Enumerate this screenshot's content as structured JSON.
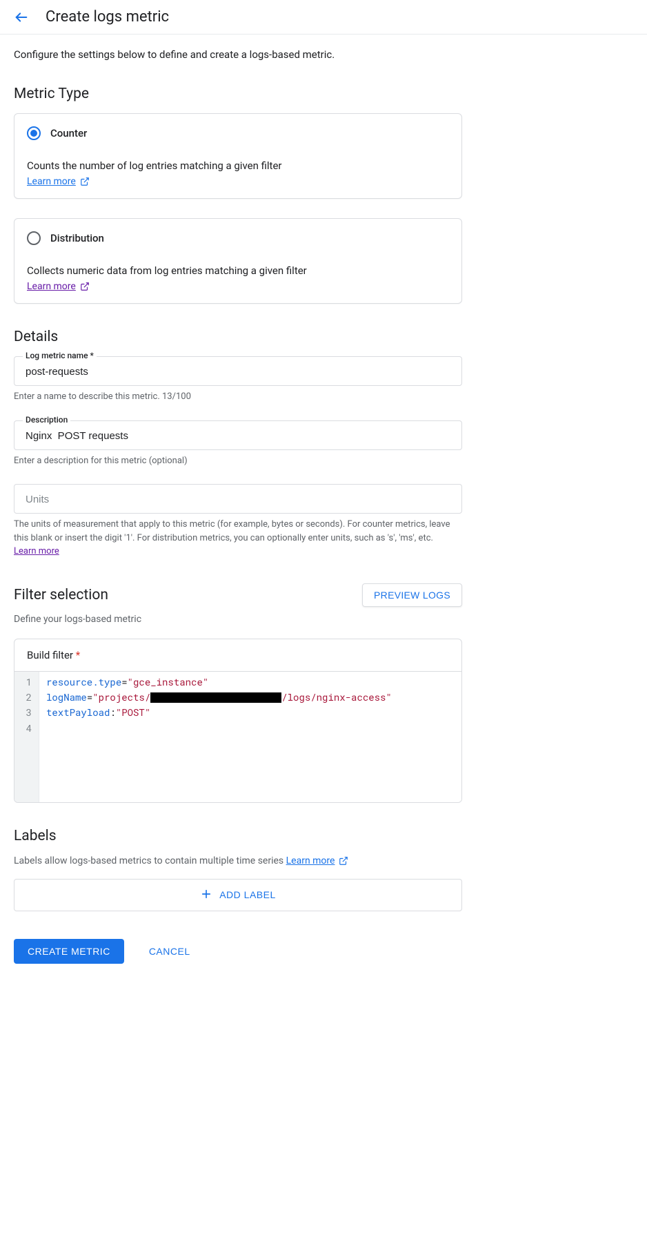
{
  "header": {
    "title": "Create logs metric"
  },
  "intro": "Configure the settings below to define and create a logs-based metric.",
  "metric_type": {
    "heading": "Metric Type",
    "counter": {
      "label": "Counter",
      "desc": "Counts the number of log entries matching a given filter",
      "learn": "Learn more"
    },
    "distribution": {
      "label": "Distribution",
      "desc": "Collects numeric data from log entries matching a given filter",
      "learn": "Learn more"
    }
  },
  "details": {
    "heading": "Details",
    "name_label": "Log metric name *",
    "name_value": "post-requests",
    "name_help": "Enter a name to describe this metric. 13/100",
    "desc_label": "Description",
    "desc_value": "Nginx  POST requests",
    "desc_help": "Enter a description for this metric (optional)",
    "units_placeholder": "Units",
    "units_help_pre": "The units of measurement that apply to this metric (for example, bytes or seconds). For counter metrics, leave this blank or insert the digit '1'. For distribution metrics, you can optionally enter units, such as 's', 'ms', etc. ",
    "units_learn": "Learn more"
  },
  "filter": {
    "heading": "Filter selection",
    "preview": "PREVIEW LOGS",
    "sub": "Define your logs-based metric",
    "build_label": "Build filter",
    "lines": {
      "1": {
        "k": "resource.type",
        "op": "=",
        "v": "\"gce_instance\""
      },
      "2": {
        "k": "logName",
        "op": "=",
        "v1": "\"projects/",
        "v2": "/logs/nginx-access\""
      },
      "3": {
        "k": "textPayload",
        "op": ":",
        "v": "\"POST\""
      }
    }
  },
  "labels": {
    "heading": "Labels",
    "desc": "Labels allow logs-based metrics to contain multiple time series ",
    "learn": "Learn more",
    "add": "ADD LABEL"
  },
  "actions": {
    "create": "CREATE METRIC",
    "cancel": "CANCEL"
  }
}
